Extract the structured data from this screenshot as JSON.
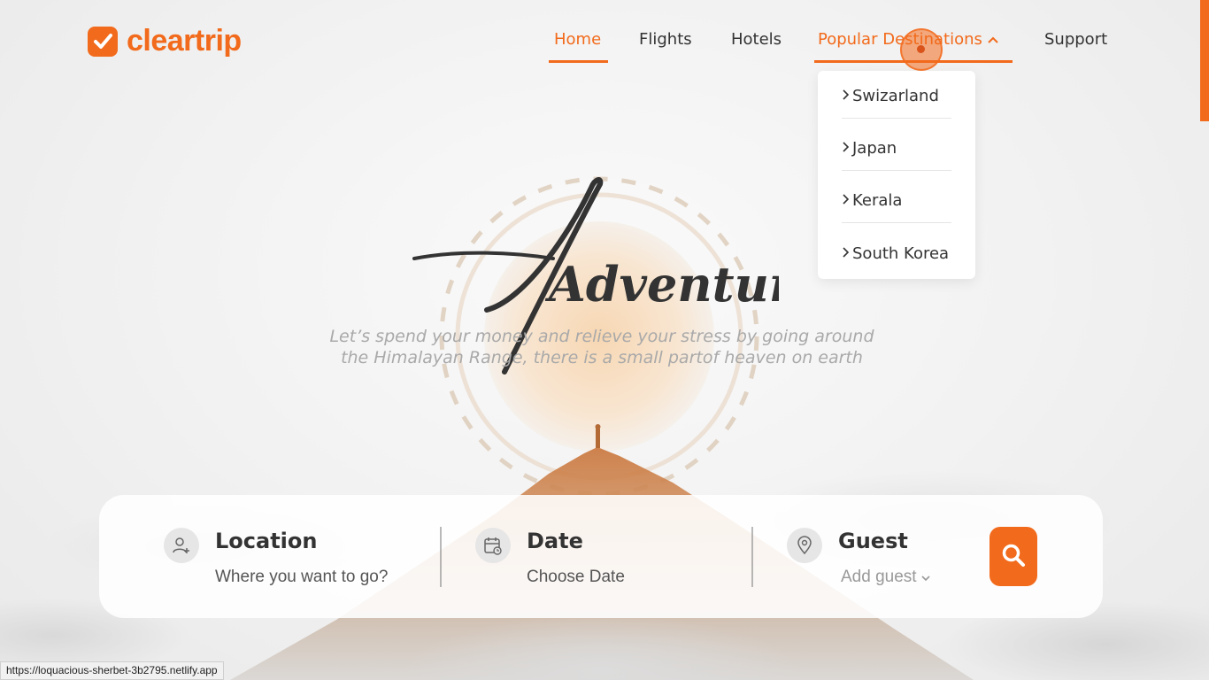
{
  "brand": {
    "name": "cleartrip",
    "color": "#f26a1b"
  },
  "nav": {
    "items": [
      {
        "label": "Home",
        "active": true
      },
      {
        "label": "Flights"
      },
      {
        "label": "Hotels"
      },
      {
        "label": "Popular Destinations",
        "expanded": true
      },
      {
        "label": "Support"
      }
    ]
  },
  "dropdown": {
    "items": [
      "Swizarland",
      "Japan",
      "Kerala",
      "South Korea"
    ]
  },
  "hero": {
    "title": "Adventure",
    "tagline_line1": "Let’s spend your money and relieve your stress by going around",
    "tagline_line2": "the Himalayan Range, there is a small partof heaven on earth"
  },
  "search": {
    "location": {
      "title": "Location",
      "placeholder": "Where you want to go?",
      "icon": "user-plus-icon"
    },
    "date": {
      "title": "Date",
      "placeholder": "Choose Date",
      "icon": "calendar-icon"
    },
    "guest": {
      "title": "Guest",
      "placeholder": "Add guest",
      "icon": "location-pin-icon"
    },
    "button_icon": "search-icon"
  },
  "status_url": "https://loquacious-sherbet-3b2795.netlify.app"
}
